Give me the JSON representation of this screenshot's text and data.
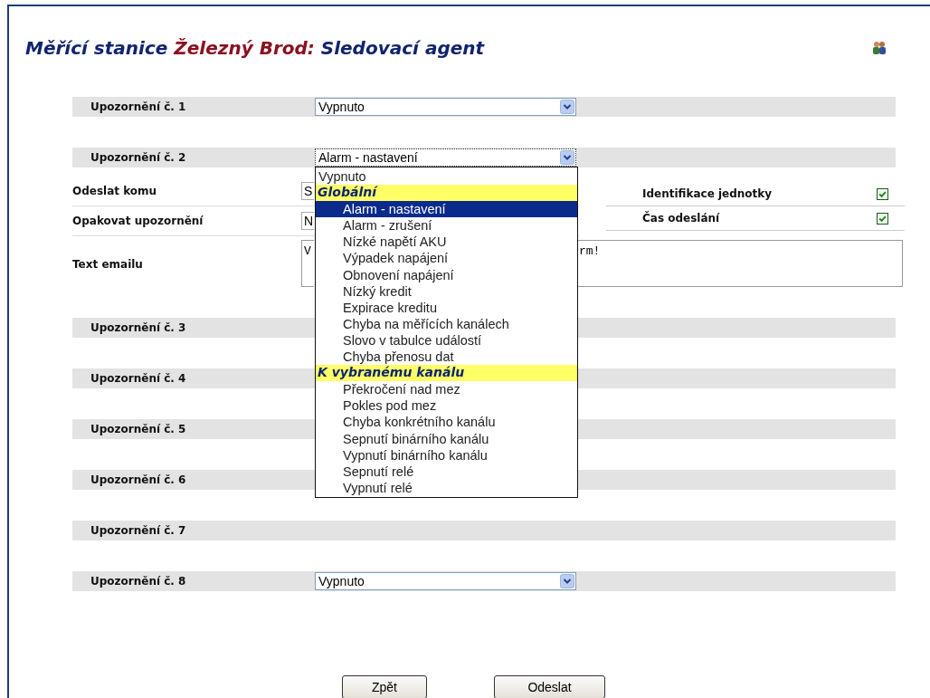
{
  "title": [
    {
      "text": "Měřící stanice ",
      "color": "#10246e"
    },
    {
      "text": "Železný Brod:",
      "color": "#8c1020"
    },
    {
      "text": " Sledovací agent",
      "color": "#10246e"
    }
  ],
  "alerts": [
    {
      "label": "Upozornění č. 1",
      "value": "Vypnuto",
      "expanded": false
    },
    {
      "label": "Upozornění č. 2",
      "value": "Alarm - nastavení",
      "expanded": true,
      "options": [
        {
          "kind": "option",
          "label": "Vypnuto",
          "selected": false
        },
        {
          "kind": "group",
          "label": "Globální"
        },
        {
          "kind": "option",
          "label": "Alarm - nastavení",
          "selected": true
        },
        {
          "kind": "option",
          "label": "Alarm - zrušení",
          "selected": false
        },
        {
          "kind": "option",
          "label": "Nízké napětí AKU",
          "selected": false
        },
        {
          "kind": "option",
          "label": "Výpadek napájení",
          "selected": false
        },
        {
          "kind": "option",
          "label": "Obnovení napájení",
          "selected": false
        },
        {
          "kind": "option",
          "label": "Nízký kredit",
          "selected": false
        },
        {
          "kind": "option",
          "label": "Expirace kreditu",
          "selected": false
        },
        {
          "kind": "option",
          "label": "Chyba na měřících kanálech",
          "selected": false
        },
        {
          "kind": "option",
          "label": "Slovo v tabulce událostí",
          "selected": false
        },
        {
          "kind": "option",
          "label": "Chyba přenosu dat",
          "selected": false
        },
        {
          "kind": "group",
          "label": "K vybranému kanálu"
        },
        {
          "kind": "option",
          "label": "Překročení nad mez",
          "selected": false
        },
        {
          "kind": "option",
          "label": "Pokles pod mez",
          "selected": false
        },
        {
          "kind": "option",
          "label": "Chyba konkrétního kanálu",
          "selected": false
        },
        {
          "kind": "option",
          "label": "Sepnutí binárního kanálu",
          "selected": false
        },
        {
          "kind": "option",
          "label": "Vypnutí binárního kanálu",
          "selected": false
        },
        {
          "kind": "option",
          "label": "Sepnutí relé",
          "selected": false
        },
        {
          "kind": "option",
          "label": "Vypnutí relé",
          "selected": false
        }
      ],
      "details": {
        "send_to": {
          "label": "Odeslat komu",
          "value": "S"
        },
        "repeat": {
          "label": "Opakovat upozornění",
          "value": "N"
        },
        "email_text": {
          "label": "Text emailu",
          "value_left": "V",
          "value_right": "rm!"
        },
        "checks": [
          {
            "label": "Identifikace jednotky",
            "checked": true
          },
          {
            "label": "Čas odeslání",
            "checked": true
          }
        ]
      }
    },
    {
      "label": "Upozornění č. 3"
    },
    {
      "label": "Upozornění č. 4"
    },
    {
      "label": "Upozornění č. 5"
    },
    {
      "label": "Upozornění č. 6"
    },
    {
      "label": "Upozornění č. 7"
    },
    {
      "label": "Upozornění č. 8",
      "value": "Vypnuto",
      "expanded": false
    }
  ],
  "buttons": [
    {
      "label": "Zpět"
    },
    {
      "label": "Odeslat"
    }
  ]
}
